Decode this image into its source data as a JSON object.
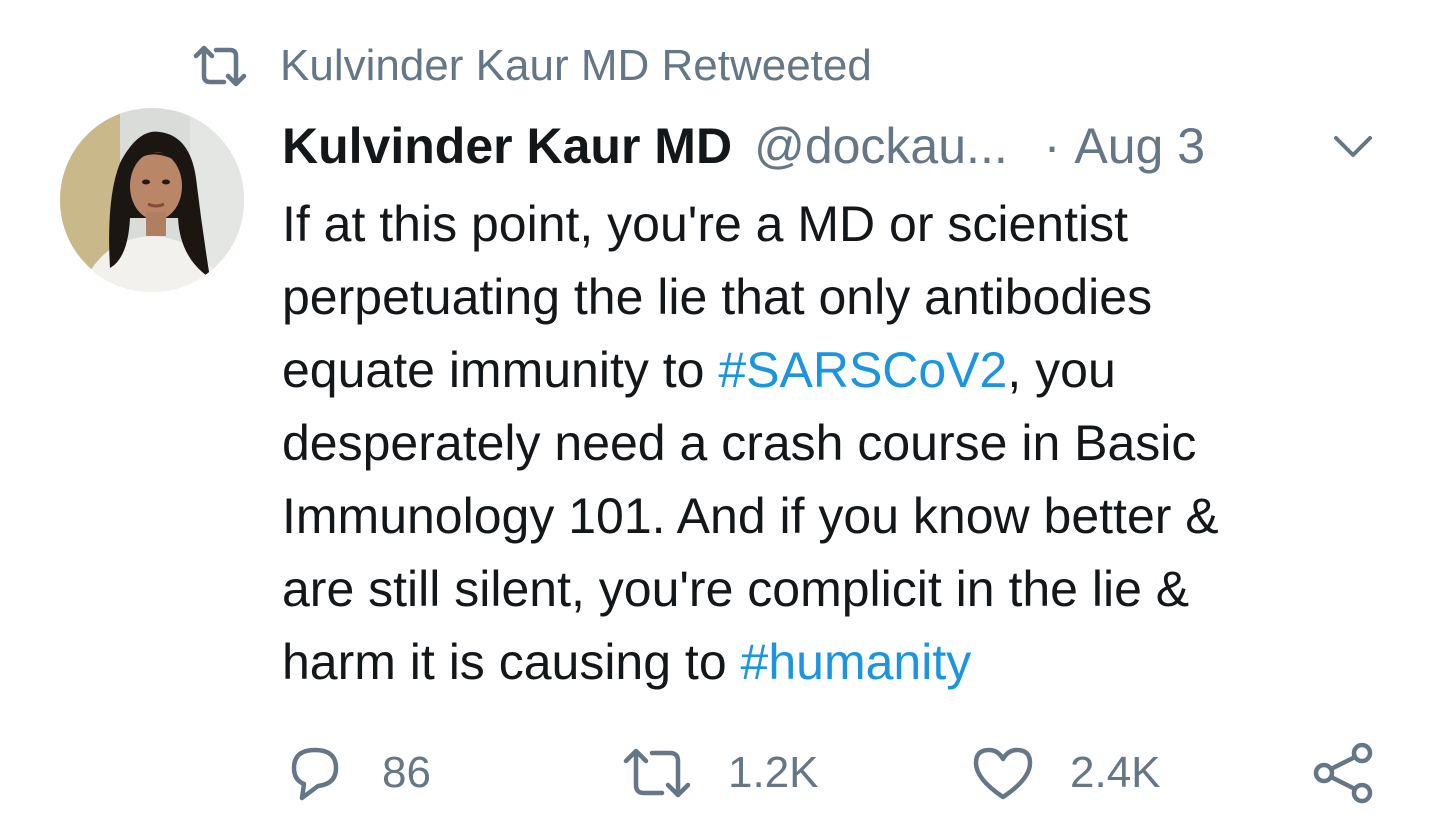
{
  "retweet_banner": {
    "icon": "retweet-icon",
    "text": "Kulvinder Kaur MD Retweeted"
  },
  "tweet": {
    "avatar_icon": "profile-avatar",
    "author_name": "Kulvinder Kaur MD",
    "handle": "@dockau...",
    "separator": "·",
    "date": "Aug 3",
    "menu_icon": "chevron-down-icon",
    "text_lines": {
      "l1": "If at this point, you're a MD or scientist",
      "l2": "perpetuating the lie that only antibodies",
      "l3_before": "equate immunity to ",
      "l3_hashtag": "#SARSCoV2",
      "l3_after": ", you",
      "l4": "desperately need a crash course in Basic",
      "l5": "Immunology 101. And if you know better &",
      "l6": "are still silent, you're complicit in the lie &",
      "l7_before": "harm it is causing to ",
      "l7_hashtag": "#humanity"
    },
    "hashtag_color": "#1b95e0"
  },
  "actions": {
    "reply": {
      "icon": "reply-icon",
      "count": "86"
    },
    "retweet": {
      "icon": "retweet-icon",
      "count": "1.2K"
    },
    "like": {
      "icon": "heart-icon",
      "count": "2.4K"
    },
    "share": {
      "icon": "share-icon"
    }
  },
  "colors": {
    "text_primary": "#14171a",
    "text_secondary": "#657786",
    "link": "#1b95e0"
  }
}
